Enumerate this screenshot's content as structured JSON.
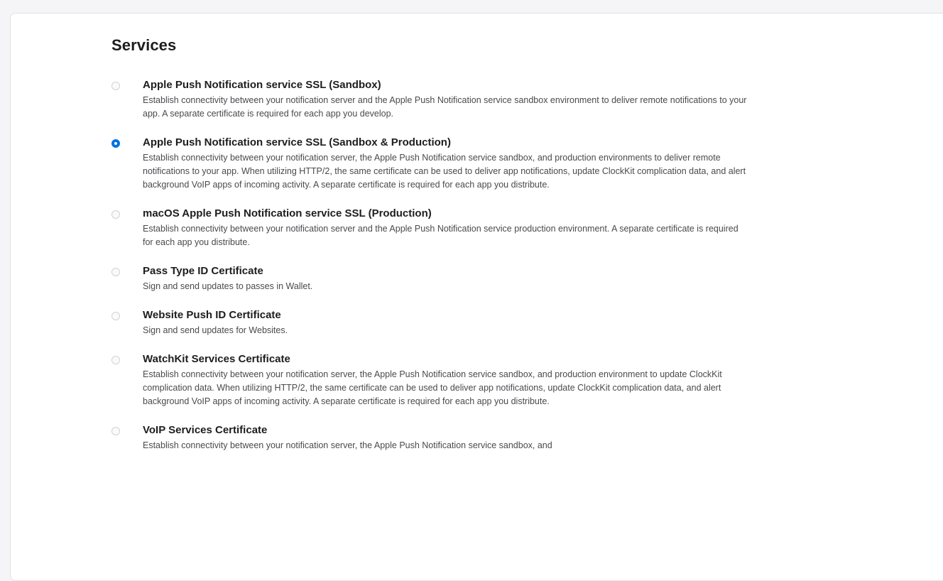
{
  "section": {
    "title": "Services"
  },
  "options": [
    {
      "title": "Apple Push Notification service SSL (Sandbox)",
      "description": "Establish connectivity between your notification server and the Apple Push Notification service sandbox environment to deliver remote notifications to your app. A separate certificate is required for each app you develop.",
      "selected": false
    },
    {
      "title": "Apple Push Notification service SSL (Sandbox & Production)",
      "description": "Establish connectivity between your notification server, the Apple Push Notification service sandbox, and production environments to deliver remote notifications to your app. When utilizing HTTP/2, the same certificate can be used to deliver app notifications, update ClockKit complication data, and alert background VoIP apps of incoming activity. A separate certificate is required for each app you distribute.",
      "selected": true
    },
    {
      "title": "macOS Apple Push Notification service SSL (Production)",
      "description": "Establish connectivity between your notification server and the Apple Push Notification service production environment. A separate certificate is required for each app you distribute.",
      "selected": false
    },
    {
      "title": "Pass Type ID Certificate",
      "description": "Sign and send updates to passes in Wallet.",
      "selected": false
    },
    {
      "title": "Website Push ID Certificate",
      "description": "Sign and send updates for Websites.",
      "selected": false
    },
    {
      "title": "WatchKit Services Certificate",
      "description": "Establish connectivity between your notification server, the Apple Push Notification service sandbox, and production environment to update ClockKit complication data. When utilizing HTTP/2, the same certificate can be used to deliver app notifications, update ClockKit complication data, and alert background VoIP apps of incoming activity. A separate certificate is required for each app you distribute.",
      "selected": false
    },
    {
      "title": "VoIP Services Certificate",
      "description": "Establish connectivity between your notification server, the Apple Push Notification service sandbox, and",
      "selected": false
    }
  ],
  "colors": {
    "accent": "#0071e3",
    "text": "#1d1d1f",
    "secondary_text": "#4a4a4f"
  }
}
